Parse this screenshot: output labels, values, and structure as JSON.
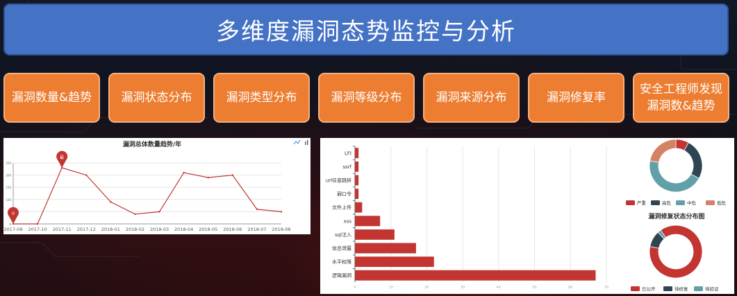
{
  "page": {
    "title": "多维度漏洞态势监控与分析"
  },
  "nav_buttons": [
    {
      "label": "漏洞数量&趋势"
    },
    {
      "label": "漏洞状态分布"
    },
    {
      "label": "漏洞类型分布"
    },
    {
      "label": "漏洞等级分布"
    },
    {
      "label": "漏洞来源分布"
    },
    {
      "label": "漏洞修复率"
    },
    {
      "label": "安全工程师发现\n漏洞数&趋势"
    }
  ],
  "colors": {
    "title_bg": "#4472c4",
    "button_bg": "#ed7d31",
    "series_red": "#c23531",
    "dark_slate": "#2f4554",
    "teal": "#61a0a8",
    "salmon": "#d48265"
  },
  "toolbox_icons": [
    "line-chart-icon",
    "bar-chart-icon"
  ],
  "chart_data": [
    {
      "type": "line",
      "title": "漏洞总体数量趋势/年",
      "x": [
        "2017-09",
        "2017-10",
        "2017-11",
        "2017-12",
        "2018-01",
        "2018-02",
        "2018-03",
        "2018-04",
        "2018-05",
        "2018-06",
        "2018-07",
        "2018-08"
      ],
      "values": [
        0,
        0,
        230,
        200,
        90,
        40,
        50,
        210,
        190,
        200,
        60,
        50
      ],
      "ylim": [
        0,
        250
      ],
      "yticks": [
        "0",
        "50",
        "100",
        "150",
        "200",
        "250"
      ],
      "markers": [
        {
          "label": "最",
          "x": "2017-11"
        },
        {
          "label": "0",
          "x": "2017-09"
        }
      ],
      "grid": true
    },
    {
      "type": "bar",
      "orientation": "horizontal",
      "categories": [
        "LFI",
        "ssrf",
        "url任意跳转",
        "弱口令",
        "文件上传",
        "xss",
        "sql注入",
        "信息泄露",
        "水平权限",
        "逻辑漏洞"
      ],
      "values": [
        1,
        1,
        1,
        1,
        2,
        7,
        11,
        17,
        22,
        67
      ],
      "xlim": [
        0,
        70
      ],
      "xticks": [
        "0",
        "10",
        "20",
        "30",
        "40",
        "50",
        "60",
        "70"
      ],
      "grid": true
    },
    {
      "type": "pie",
      "variant": "donut",
      "slices": [
        {
          "name": "严重",
          "value": 8
        },
        {
          "name": "高危",
          "value": 25
        },
        {
          "name": "中危",
          "value": 45
        },
        {
          "name": "低危",
          "value": 22
        }
      ],
      "legend": [
        "严重",
        "高危",
        "中危",
        "低危"
      ],
      "legend_placement": "bottom"
    },
    {
      "type": "pie",
      "variant": "donut",
      "title": "漏洞修复状态分布图",
      "slices": [
        {
          "name": "已公开",
          "value": 88
        },
        {
          "name": "待修复",
          "value": 10
        },
        {
          "name": "待验证",
          "value": 2
        }
      ],
      "legend": [
        "已公开",
        "待修复",
        "待验证"
      ],
      "legend_placement": "bottom"
    }
  ]
}
